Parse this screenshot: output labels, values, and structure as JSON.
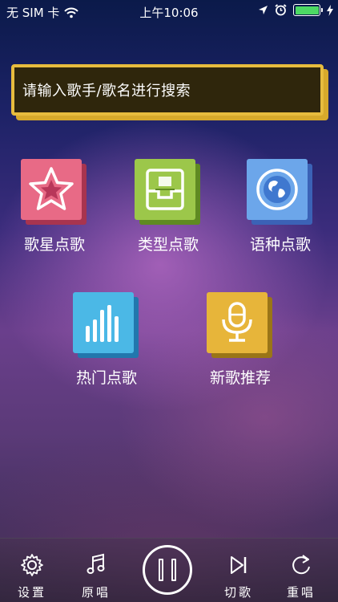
{
  "status_bar": {
    "carrier": "无 SIM 卡",
    "time": "上午10:06",
    "battery_color": "#4cd964"
  },
  "search": {
    "placeholder": "请输入歌手/歌名进行搜索"
  },
  "menu": {
    "items": [
      {
        "label": "歌星点歌",
        "icon": "star-icon",
        "color": "#e86a86"
      },
      {
        "label": "类型点歌",
        "icon": "inbox-icon",
        "color": "#9cc74a"
      },
      {
        "label": "语种点歌",
        "icon": "globe-icon",
        "color": "#6ca6ea"
      },
      {
        "label": "热门点歌",
        "icon": "bar-chart-icon",
        "color": "#4bb8e6"
      },
      {
        "label": "新歌推荐",
        "icon": "microphone-icon",
        "color": "#e7b53a"
      }
    ]
  },
  "tabbar": {
    "settings": "设置",
    "original": "原唱",
    "pause": "pause-icon",
    "skip": "切歌",
    "replay": "重唱"
  },
  "colors": {
    "search_border": "#e7bc3e",
    "search_bg": "#2f260c"
  }
}
